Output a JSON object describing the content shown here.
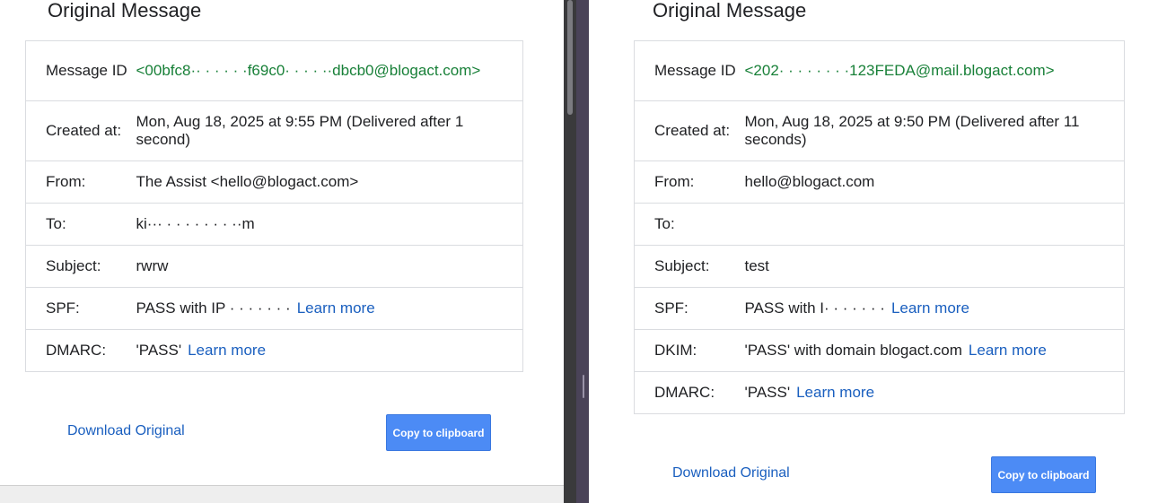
{
  "left": {
    "heading": "Original Message",
    "rows": {
      "message_id": {
        "label": "Message ID",
        "value": "<00bfc8·· · · · · ·f69c0· · · · ··dbcb0@blogact.com>"
      },
      "created_at": {
        "label": "Created at:",
        "value": "Mon, Aug 18, 2025 at 9:55 PM (Delivered after 1 second)"
      },
      "from": {
        "label": "From:",
        "value": "The Assist <hello@blogact.com>"
      },
      "to": {
        "label": "To:",
        "value": "ki··· · · · · · · · ··m"
      },
      "subject": {
        "label": "Subject:",
        "value": "rwrw"
      },
      "spf": {
        "label": "SPF:",
        "value": "PASS with IP · · · · · · ·",
        "link": "Learn more"
      },
      "dmarc": {
        "label": "DMARC:",
        "value": "'PASS'",
        "link": "Learn more"
      }
    },
    "download_label": "Download Original",
    "copy_label": "Copy to clipboard"
  },
  "right": {
    "heading": "Original Message",
    "rows": {
      "message_id": {
        "label": "Message ID",
        "value": "<202· · · · · · · ·123FEDA@mail.blogact.com>"
      },
      "created_at": {
        "label": "Created at:",
        "value": "Mon, Aug 18, 2025 at 9:50 PM (Delivered after 11 seconds)"
      },
      "from": {
        "label": "From:",
        "value": "hello@blogact.com"
      },
      "to": {
        "label": "To:",
        "value": ""
      },
      "subject": {
        "label": "Subject:",
        "value": "test"
      },
      "spf": {
        "label": "SPF:",
        "value": "PASS with I· · · · · · ·",
        "link": "Learn more"
      },
      "dkim": {
        "label": "DKIM:",
        "value": "'PASS' with domain blogact.com",
        "link": "Learn more"
      },
      "dmarc": {
        "label": "DMARC:",
        "value": "'PASS'",
        "link": "Learn more"
      }
    },
    "download_label": "Download Original",
    "copy_label": "Copy to clipboard"
  },
  "colors": {
    "message_id": "#188038",
    "link": "#1a5fbf",
    "button": "#4c8bf5"
  }
}
